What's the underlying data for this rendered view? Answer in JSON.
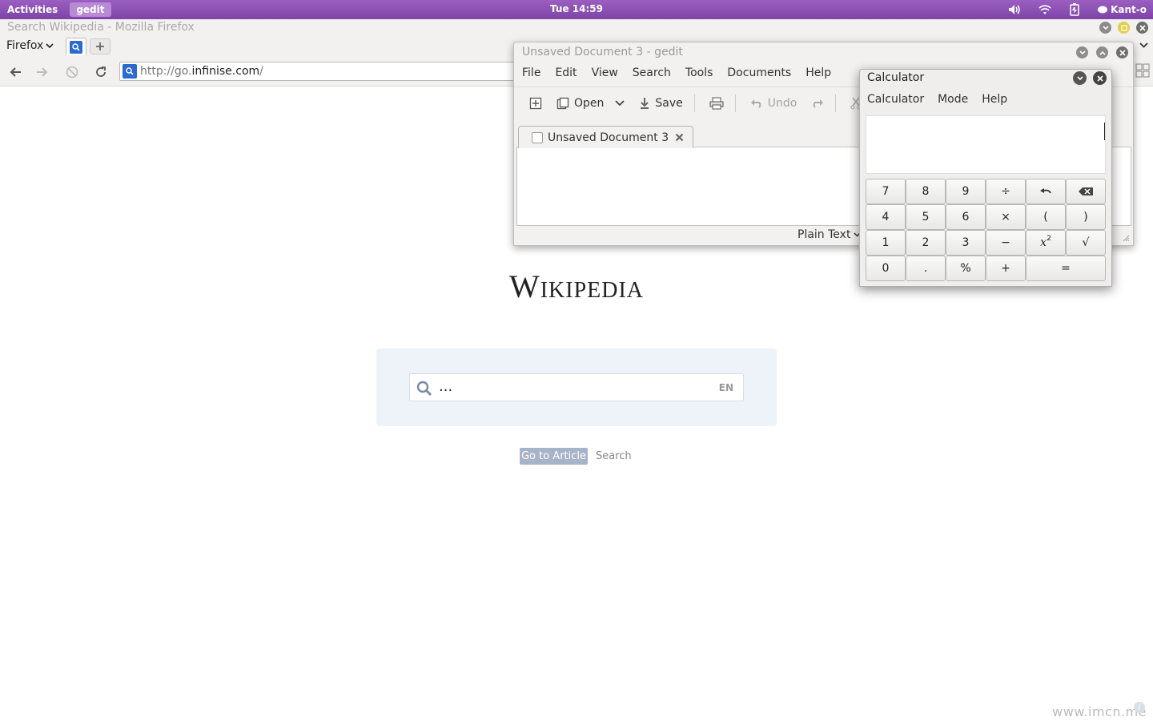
{
  "topbar": {
    "activities": "Activities",
    "app_name": "gedit",
    "clock": "Tue 14:59",
    "user": "Kant-o",
    "bg_color": "#8a50b4"
  },
  "firefox": {
    "window_title": "Search Wikipedia - Mozilla Firefox",
    "menu_label": "Firefox",
    "url_prefix": "http://go.",
    "url_domain": "infinise.com",
    "url_suffix": "/"
  },
  "wikipedia": {
    "logo_text": "Wikipedia",
    "search_value": "...",
    "lang_label": "EN",
    "go_button": "Go to Article",
    "search_link": "Search",
    "panel_color": "#eef2f9"
  },
  "gedit": {
    "window_title": "Unsaved Document 3 - gedit",
    "menu": [
      "File",
      "Edit",
      "View",
      "Search",
      "Tools",
      "Documents",
      "Help"
    ],
    "toolbar": {
      "open": "Open",
      "save": "Save",
      "undo": "Undo"
    },
    "doc_tab": "Unsaved Document 3",
    "language": "Plain Text"
  },
  "calculator": {
    "window_title": "Calculator",
    "menu": [
      "Calculator",
      "Mode",
      "Help"
    ],
    "display_value": "",
    "keys": [
      "7",
      "8",
      "9",
      "÷",
      "undo",
      "backspace",
      "4",
      "5",
      "6",
      "×",
      "(",
      ")",
      "1",
      "2",
      "3",
      "−",
      "x2",
      "√",
      "0",
      ".",
      "%",
      "+",
      "="
    ]
  },
  "watermark": "www.imcn.me"
}
